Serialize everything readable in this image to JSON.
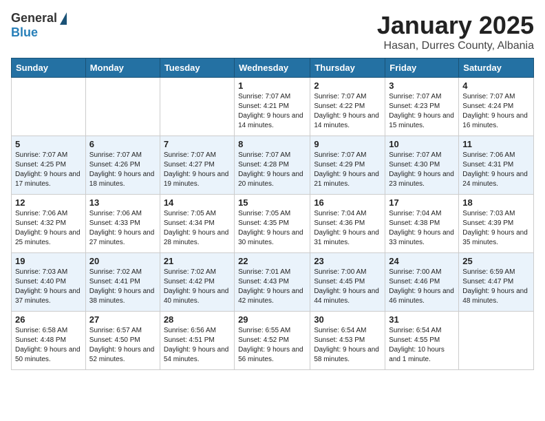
{
  "header": {
    "logo_general": "General",
    "logo_blue": "Blue",
    "month": "January 2025",
    "location": "Hasan, Durres County, Albania"
  },
  "weekdays": [
    "Sunday",
    "Monday",
    "Tuesday",
    "Wednesday",
    "Thursday",
    "Friday",
    "Saturday"
  ],
  "weeks": [
    [
      {
        "day": null
      },
      {
        "day": null
      },
      {
        "day": null
      },
      {
        "day": "1",
        "sunrise": "7:07 AM",
        "sunset": "4:21 PM",
        "daylight": "9 hours and 14 minutes."
      },
      {
        "day": "2",
        "sunrise": "7:07 AM",
        "sunset": "4:22 PM",
        "daylight": "9 hours and 14 minutes."
      },
      {
        "day": "3",
        "sunrise": "7:07 AM",
        "sunset": "4:23 PM",
        "daylight": "9 hours and 15 minutes."
      },
      {
        "day": "4",
        "sunrise": "7:07 AM",
        "sunset": "4:24 PM",
        "daylight": "9 hours and 16 minutes."
      }
    ],
    [
      {
        "day": "5",
        "sunrise": "7:07 AM",
        "sunset": "4:25 PM",
        "daylight": "9 hours and 17 minutes."
      },
      {
        "day": "6",
        "sunrise": "7:07 AM",
        "sunset": "4:26 PM",
        "daylight": "9 hours and 18 minutes."
      },
      {
        "day": "7",
        "sunrise": "7:07 AM",
        "sunset": "4:27 PM",
        "daylight": "9 hours and 19 minutes."
      },
      {
        "day": "8",
        "sunrise": "7:07 AM",
        "sunset": "4:28 PM",
        "daylight": "9 hours and 20 minutes."
      },
      {
        "day": "9",
        "sunrise": "7:07 AM",
        "sunset": "4:29 PM",
        "daylight": "9 hours and 21 minutes."
      },
      {
        "day": "10",
        "sunrise": "7:07 AM",
        "sunset": "4:30 PM",
        "daylight": "9 hours and 23 minutes."
      },
      {
        "day": "11",
        "sunrise": "7:06 AM",
        "sunset": "4:31 PM",
        "daylight": "9 hours and 24 minutes."
      }
    ],
    [
      {
        "day": "12",
        "sunrise": "7:06 AM",
        "sunset": "4:32 PM",
        "daylight": "9 hours and 25 minutes."
      },
      {
        "day": "13",
        "sunrise": "7:06 AM",
        "sunset": "4:33 PM",
        "daylight": "9 hours and 27 minutes."
      },
      {
        "day": "14",
        "sunrise": "7:05 AM",
        "sunset": "4:34 PM",
        "daylight": "9 hours and 28 minutes."
      },
      {
        "day": "15",
        "sunrise": "7:05 AM",
        "sunset": "4:35 PM",
        "daylight": "9 hours and 30 minutes."
      },
      {
        "day": "16",
        "sunrise": "7:04 AM",
        "sunset": "4:36 PM",
        "daylight": "9 hours and 31 minutes."
      },
      {
        "day": "17",
        "sunrise": "7:04 AM",
        "sunset": "4:38 PM",
        "daylight": "9 hours and 33 minutes."
      },
      {
        "day": "18",
        "sunrise": "7:03 AM",
        "sunset": "4:39 PM",
        "daylight": "9 hours and 35 minutes."
      }
    ],
    [
      {
        "day": "19",
        "sunrise": "7:03 AM",
        "sunset": "4:40 PM",
        "daylight": "9 hours and 37 minutes."
      },
      {
        "day": "20",
        "sunrise": "7:02 AM",
        "sunset": "4:41 PM",
        "daylight": "9 hours and 38 minutes."
      },
      {
        "day": "21",
        "sunrise": "7:02 AM",
        "sunset": "4:42 PM",
        "daylight": "9 hours and 40 minutes."
      },
      {
        "day": "22",
        "sunrise": "7:01 AM",
        "sunset": "4:43 PM",
        "daylight": "9 hours and 42 minutes."
      },
      {
        "day": "23",
        "sunrise": "7:00 AM",
        "sunset": "4:45 PM",
        "daylight": "9 hours and 44 minutes."
      },
      {
        "day": "24",
        "sunrise": "7:00 AM",
        "sunset": "4:46 PM",
        "daylight": "9 hours and 46 minutes."
      },
      {
        "day": "25",
        "sunrise": "6:59 AM",
        "sunset": "4:47 PM",
        "daylight": "9 hours and 48 minutes."
      }
    ],
    [
      {
        "day": "26",
        "sunrise": "6:58 AM",
        "sunset": "4:48 PM",
        "daylight": "9 hours and 50 minutes."
      },
      {
        "day": "27",
        "sunrise": "6:57 AM",
        "sunset": "4:50 PM",
        "daylight": "9 hours and 52 minutes."
      },
      {
        "day": "28",
        "sunrise": "6:56 AM",
        "sunset": "4:51 PM",
        "daylight": "9 hours and 54 minutes."
      },
      {
        "day": "29",
        "sunrise": "6:55 AM",
        "sunset": "4:52 PM",
        "daylight": "9 hours and 56 minutes."
      },
      {
        "day": "30",
        "sunrise": "6:54 AM",
        "sunset": "4:53 PM",
        "daylight": "9 hours and 58 minutes."
      },
      {
        "day": "31",
        "sunrise": "6:54 AM",
        "sunset": "4:55 PM",
        "daylight": "10 hours and 1 minute."
      },
      {
        "day": null
      }
    ]
  ],
  "labels": {
    "sunrise": "Sunrise:",
    "sunset": "Sunset:",
    "daylight": "Daylight:"
  }
}
